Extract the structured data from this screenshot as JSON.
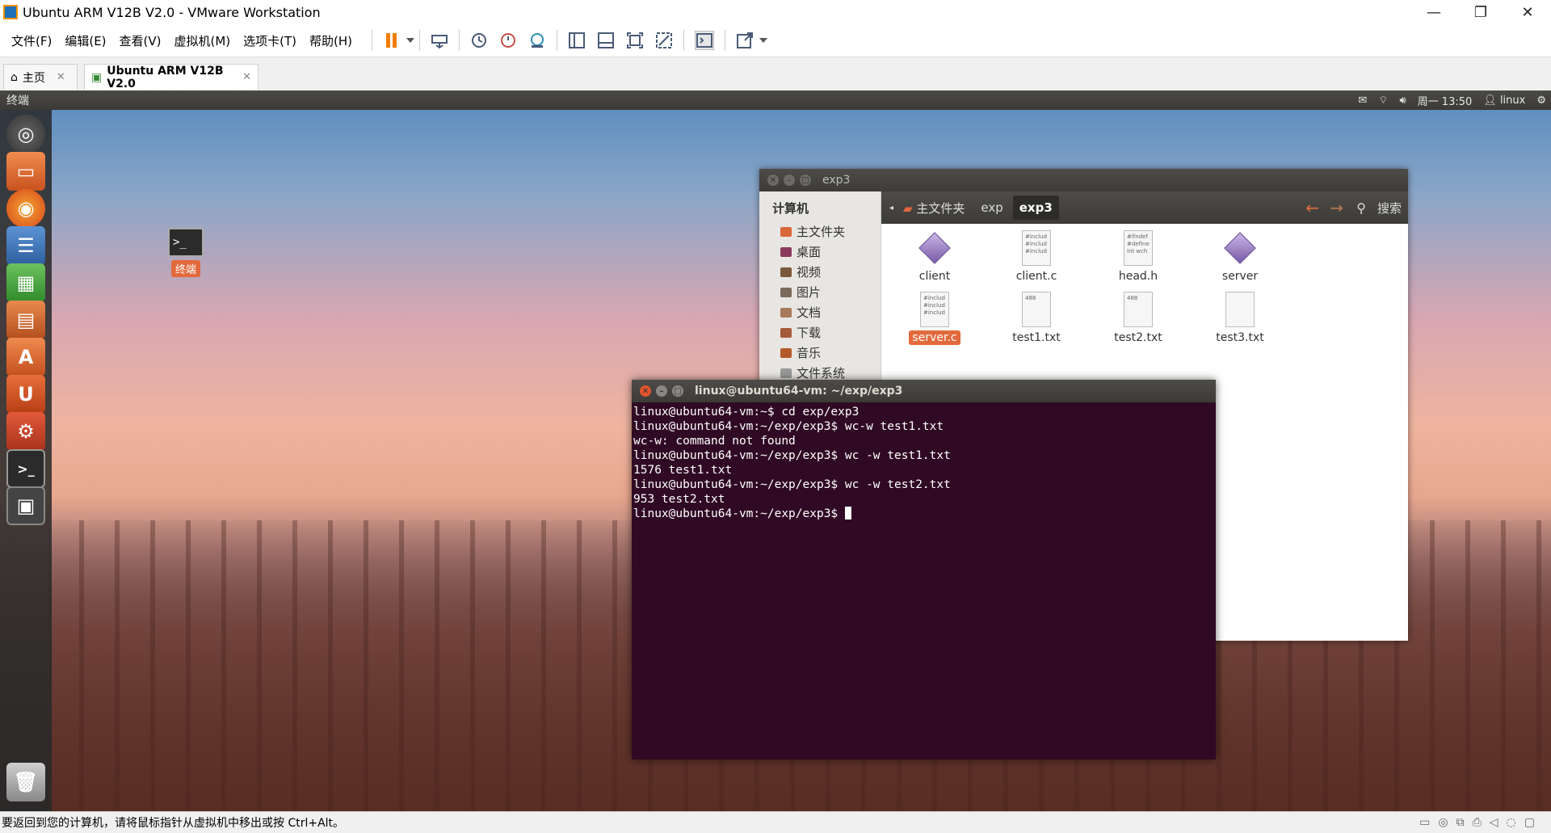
{
  "window": {
    "title": "Ubuntu ARM V12B V2.0 - VMware Workstation",
    "minimize": "—",
    "restore": "❐",
    "close": "✕"
  },
  "menu": [
    "文件(F)",
    "编辑(E)",
    "查看(V)",
    "虚拟机(M)",
    "选项卡(T)",
    "帮助(H)"
  ],
  "tabs": [
    {
      "label": "主页",
      "close": "✕"
    },
    {
      "label": "Ubuntu ARM V12B V2.0",
      "close": "✕"
    }
  ],
  "panel": {
    "app_name": "终端",
    "clock": "周一 13:50",
    "user": "linux"
  },
  "desktop_icon": {
    "label": "终端",
    "glyph": ">_"
  },
  "file_manager": {
    "title": "exp3",
    "sidebar_header": "计算机",
    "sidebar_items": [
      "主文件夹",
      "桌面",
      "视频",
      "图片",
      "文档",
      "下载",
      "音乐",
      "文件系统"
    ],
    "breadcrumbs": [
      "主文件夹",
      "exp",
      "exp3"
    ],
    "search_label": "搜索",
    "files": [
      {
        "name": "client",
        "kind": "executable"
      },
      {
        "name": "client.c",
        "kind": "source",
        "preview": "#includ #includ #includ"
      },
      {
        "name": "head.h",
        "kind": "source",
        "preview": "#ifndef #define int wch"
      },
      {
        "name": "server",
        "kind": "executable"
      },
      {
        "name": "server.c",
        "kind": "source",
        "preview": "#includ #includ #includ",
        "selected": true
      },
      {
        "name": "test1.txt",
        "kind": "text",
        "preview": "488"
      },
      {
        "name": "test2.txt",
        "kind": "text",
        "preview": "488"
      },
      {
        "name": "test3.txt",
        "kind": "text",
        "preview": ""
      }
    ]
  },
  "terminal": {
    "title": "linux@ubuntu64-vm: ~/exp/exp3",
    "lines": [
      "linux@ubuntu64-vm:~$ cd exp/exp3",
      "linux@ubuntu64-vm:~/exp/exp3$ wc-w test1.txt",
      "wc-w: command not found",
      "linux@ubuntu64-vm:~/exp/exp3$ wc -w test1.txt",
      "1576 test1.txt",
      "linux@ubuntu64-vm:~/exp/exp3$ wc -w test2.txt",
      "953 test2.txt"
    ],
    "prompt": "linux@ubuntu64-vm:~/exp/exp3$ "
  },
  "status": {
    "message": "要返回到您的计算机，请将鼠标指针从虚拟机中移出或按 Ctrl+Alt。"
  },
  "colors": {
    "accent": "#e2693c",
    "terminal_bg": "#300a24",
    "panel": "#3c3b37"
  }
}
